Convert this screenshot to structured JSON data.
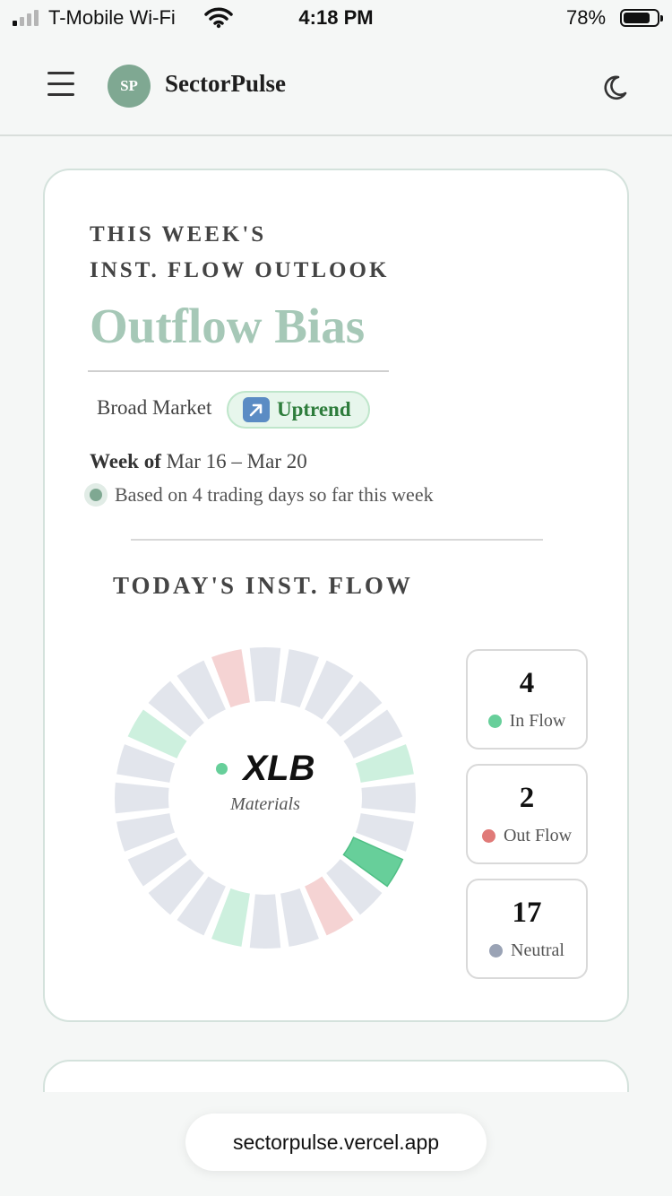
{
  "status_bar": {
    "carrier": "T-Mobile Wi-Fi",
    "time": "4:18 PM",
    "battery_percent": "78%",
    "battery_level": 0.78,
    "signal_bars_active": 1,
    "signal_bars_total": 4
  },
  "header": {
    "logo_initials": "SP",
    "brand": "SectorPulse",
    "menu_icon": "hamburger-menu-icon",
    "theme_icon": "moon-icon"
  },
  "outlook": {
    "heading_line1": "THIS WEEK'S",
    "heading_line2": "INST. FLOW OUTLOOK",
    "value": "Outflow Bias",
    "market_label": "Broad Market",
    "trend_icon": "up-right-arrow-icon",
    "trend_label": "Uptrend",
    "week_prefix": "Week of",
    "week_range": "Mar 16 – Mar 20",
    "days_note": "Based on 4 trading days so far this week"
  },
  "today": {
    "heading": "TODAY'S INST. FLOW",
    "selected_ticker": "XLB",
    "selected_name": "Materials",
    "segments": [
      "neutral",
      "neutral",
      "neutral",
      "neutral",
      "neutral",
      "inflow",
      "neutral",
      "neutral",
      "inflow-strong",
      "neutral",
      "outflow",
      "neutral",
      "neutral",
      "inflow",
      "neutral",
      "neutral",
      "neutral",
      "neutral",
      "neutral",
      "neutral",
      "inflow",
      "neutral",
      "neutral",
      "outflow"
    ],
    "selected_segment": 8,
    "stats": [
      {
        "count": "4",
        "label": "In Flow",
        "color": "#67cf9a"
      },
      {
        "count": "2",
        "label": "Out Flow",
        "color": "#e07a78"
      },
      {
        "count": "17",
        "label": "Neutral",
        "color": "#9aa3b5"
      }
    ]
  },
  "colors": {
    "accent": "#7fa892",
    "neutral_segment": "#e2e5ec",
    "inflow_segment": "#cdf0de",
    "inflow_strong_segment": "#67cf9a",
    "outflow_segment": "#f5d3d3"
  },
  "browser": {
    "url": "sectorpulse.vercel.app"
  }
}
